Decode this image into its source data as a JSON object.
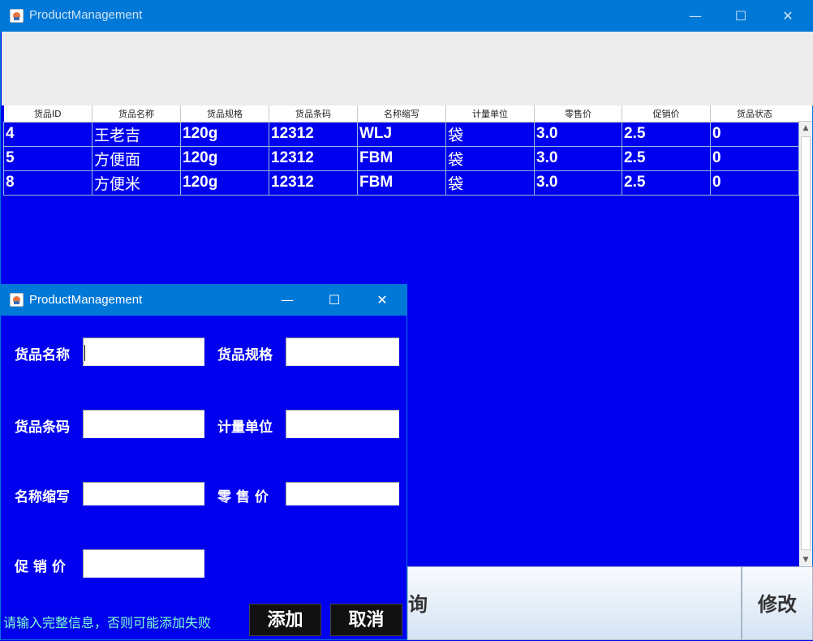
{
  "main_window": {
    "title": "ProductManagement",
    "controls": {
      "minimize": "—",
      "maximize": "☐",
      "close": "✕"
    }
  },
  "table": {
    "columns": [
      "货品ID",
      "货品名称",
      "货品规格",
      "货品条码",
      "名称缩写",
      "计量单位",
      "零售价",
      "促销价",
      "货品状态"
    ],
    "rows": [
      [
        "4",
        "王老吉",
        "120g",
        "12312",
        "WLJ",
        "袋",
        "3.0",
        "2.5",
        "0"
      ],
      [
        "5",
        "方便面",
        "120g",
        "12312",
        "FBM",
        "袋",
        "3.0",
        "2.5",
        "0"
      ],
      [
        "8",
        "方便米",
        "120g",
        "12312",
        "FBM",
        "袋",
        "3.0",
        "2.5",
        "0"
      ]
    ]
  },
  "bottom_buttons": {
    "query": "询",
    "modify": "修改"
  },
  "dialog": {
    "title": "ProductManagement",
    "controls": {
      "minimize": "—",
      "maximize": "☐",
      "close": "✕"
    },
    "fields": {
      "name_label": "货品名称",
      "name_value": "",
      "spec_label": "货品规格",
      "spec_value": "",
      "barcode_label": "货品条码",
      "barcode_value": "",
      "unit_label": "计量单位",
      "unit_value": "",
      "abbr_label": "名称缩写",
      "abbr_value": "",
      "retail_label": "零 售 价",
      "retail_value": "",
      "promo_label": "促 销 价",
      "promo_value": ""
    },
    "hint": "请输入完整信息，否则可能添加失败",
    "add_button": "添加",
    "cancel_button": "取消"
  },
  "colors": {
    "panel_blue": "#0000ee",
    "titlebar_blue": "#0078d7",
    "hint_text": "#80ffd0"
  }
}
